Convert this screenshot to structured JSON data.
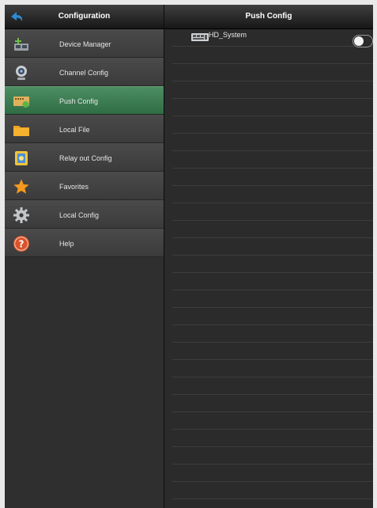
{
  "header": {
    "left_title": "Configuration",
    "right_title": "Push Config",
    "back_icon": "back-arrow-icon"
  },
  "sidebar": {
    "items": [
      {
        "label": "Device Manager",
        "icon": "device-manager-icon",
        "selected": false
      },
      {
        "label": "Channel Config",
        "icon": "webcam-icon",
        "selected": false
      },
      {
        "label": "Push Config",
        "icon": "push-config-icon",
        "selected": true
      },
      {
        "label": "Local File",
        "icon": "folder-icon",
        "selected": false
      },
      {
        "label": "Relay out Config",
        "icon": "relay-out-icon",
        "selected": false
      },
      {
        "label": "Favorites",
        "icon": "star-icon",
        "selected": false
      },
      {
        "label": "Local Config",
        "icon": "gear-icon",
        "selected": false
      },
      {
        "label": "Help",
        "icon": "help-icon",
        "selected": false
      }
    ]
  },
  "content": {
    "devices": [
      {
        "name": "HD_System",
        "icon": "dvr-device-icon",
        "push_enabled": false
      }
    ]
  },
  "colors": {
    "selected_item": "#3f7d55",
    "background": "#2b2b2b",
    "sidebar": "#3a3a3a"
  }
}
